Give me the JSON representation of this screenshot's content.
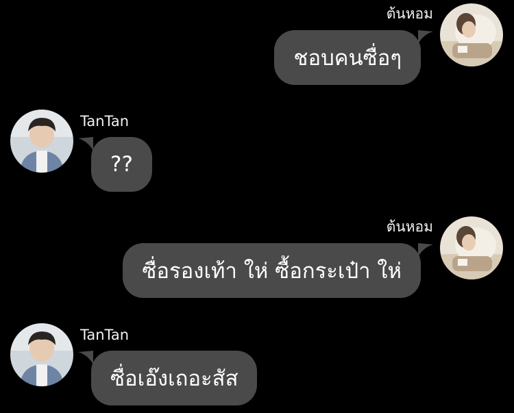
{
  "messages": [
    {
      "side": "right",
      "sender": "ต้นหอม",
      "text": "ชอบคนซื่อๆ",
      "avatar": "cream-profile-photo-icon"
    },
    {
      "side": "left",
      "sender": "TanTan",
      "text": "??",
      "avatar": "boy-denim-jacket-photo-icon"
    },
    {
      "side": "right",
      "sender": "ต้นหอม",
      "text": "ซื่อรองเท้า ให่ ซื้อกระเป๋า ให่",
      "avatar": "cream-profile-photo-icon"
    },
    {
      "side": "left",
      "sender": "TanTan",
      "text": "ซื่อเอ๊งเถอะสัส",
      "avatar": "boy-denim-jacket-photo-icon"
    }
  ],
  "colors": {
    "background": "#000000",
    "bubble": "#4a4a4a",
    "text": "#ffffff"
  }
}
